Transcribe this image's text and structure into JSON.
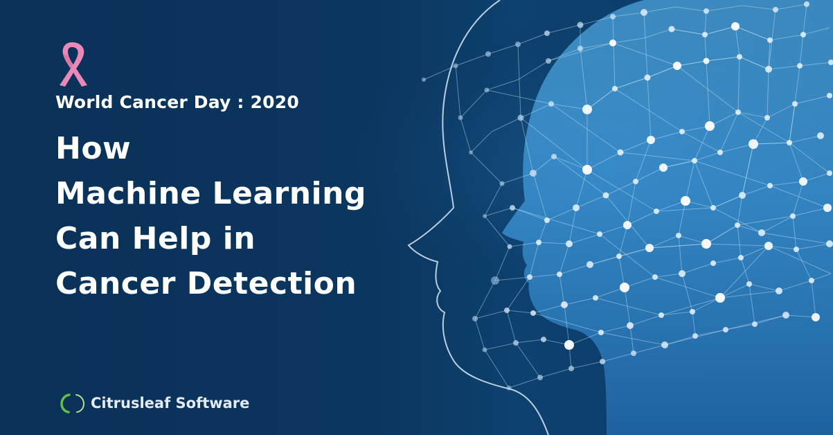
{
  "banner": {
    "subtitle": "World Cancer Day : 2020",
    "headline_lines": [
      "How",
      "Machine Learning",
      "Can Help in",
      "Cancer Detection"
    ]
  },
  "brand": {
    "name": "Citrusleaf Software"
  },
  "colors": {
    "background": "#0b365f",
    "ribbon": "#e889b7",
    "head_fill": "#4aa3e0",
    "text": "#ffffff",
    "logo_green": "#62c04a"
  }
}
